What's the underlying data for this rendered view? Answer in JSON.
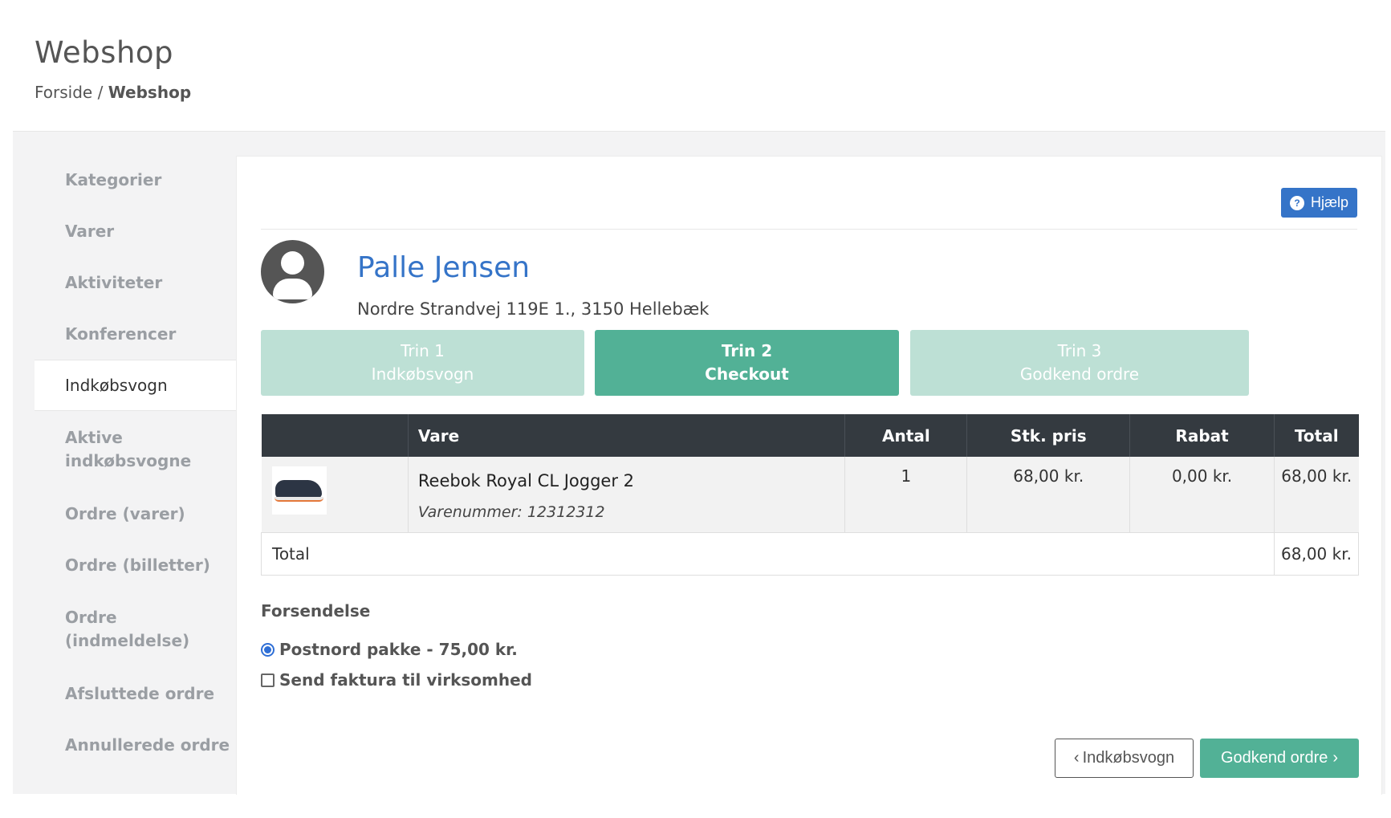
{
  "header": {
    "title": "Webshop",
    "breadcrumb": {
      "home": "Forside",
      "separator": "/",
      "current": "Webshop"
    }
  },
  "sidebar": {
    "items": [
      {
        "label": "Kategorier"
      },
      {
        "label": "Varer"
      },
      {
        "label": "Aktiviteter"
      },
      {
        "label": "Konferencer"
      },
      {
        "label": "Indkøbsvogn"
      },
      {
        "label_line1": "Aktive",
        "label_line2": "indkøbsvogne"
      },
      {
        "label": "Ordre (varer)"
      },
      {
        "label": "Ordre (billetter)"
      },
      {
        "label_line1": "Ordre",
        "label_line2": "(indmeldelse)"
      },
      {
        "label": "Afsluttede ordre"
      },
      {
        "label": "Annullerede ordre"
      }
    ]
  },
  "help": {
    "label": "Hjælp",
    "icon": "question-circle-icon"
  },
  "customer": {
    "name": "Palle Jensen",
    "address": "Nordre Strandvej 119E 1., 3150 Hellebæk",
    "avatar_icon": "user-avatar-icon"
  },
  "steps": [
    {
      "line1": "Trin 1",
      "line2": "Indkøbsvogn"
    },
    {
      "line1": "Trin 2",
      "line2": "Checkout"
    },
    {
      "line1": "Trin 3",
      "line2": "Godkend ordre"
    }
  ],
  "cart": {
    "headers": [
      "",
      "Vare",
      "Antal",
      "Stk. pris",
      "Rabat",
      "Total"
    ],
    "rows": [
      {
        "name": "Reebok Royal CL Jogger 2",
        "sku": "Varenummer: 12312312",
        "qty": "1",
        "unit_price": "68,00 kr.",
        "discount": "0,00 kr.",
        "total": "68,00 kr."
      }
    ],
    "total_label": "Total",
    "total_value": "68,00 kr."
  },
  "shipping": {
    "title": "Forsendelse",
    "option": "Postnord pakke - 75,00 kr.",
    "invoice_option": "Send faktura til virksomhed"
  },
  "actions": {
    "back_label": "Indkøbsvogn",
    "approve_label": "Godkend ordre"
  },
  "colors": {
    "accent_blue": "#3574c8",
    "step_active": "#52b196",
    "step_inactive": "#bde0d5",
    "table_header": "#343a40"
  }
}
